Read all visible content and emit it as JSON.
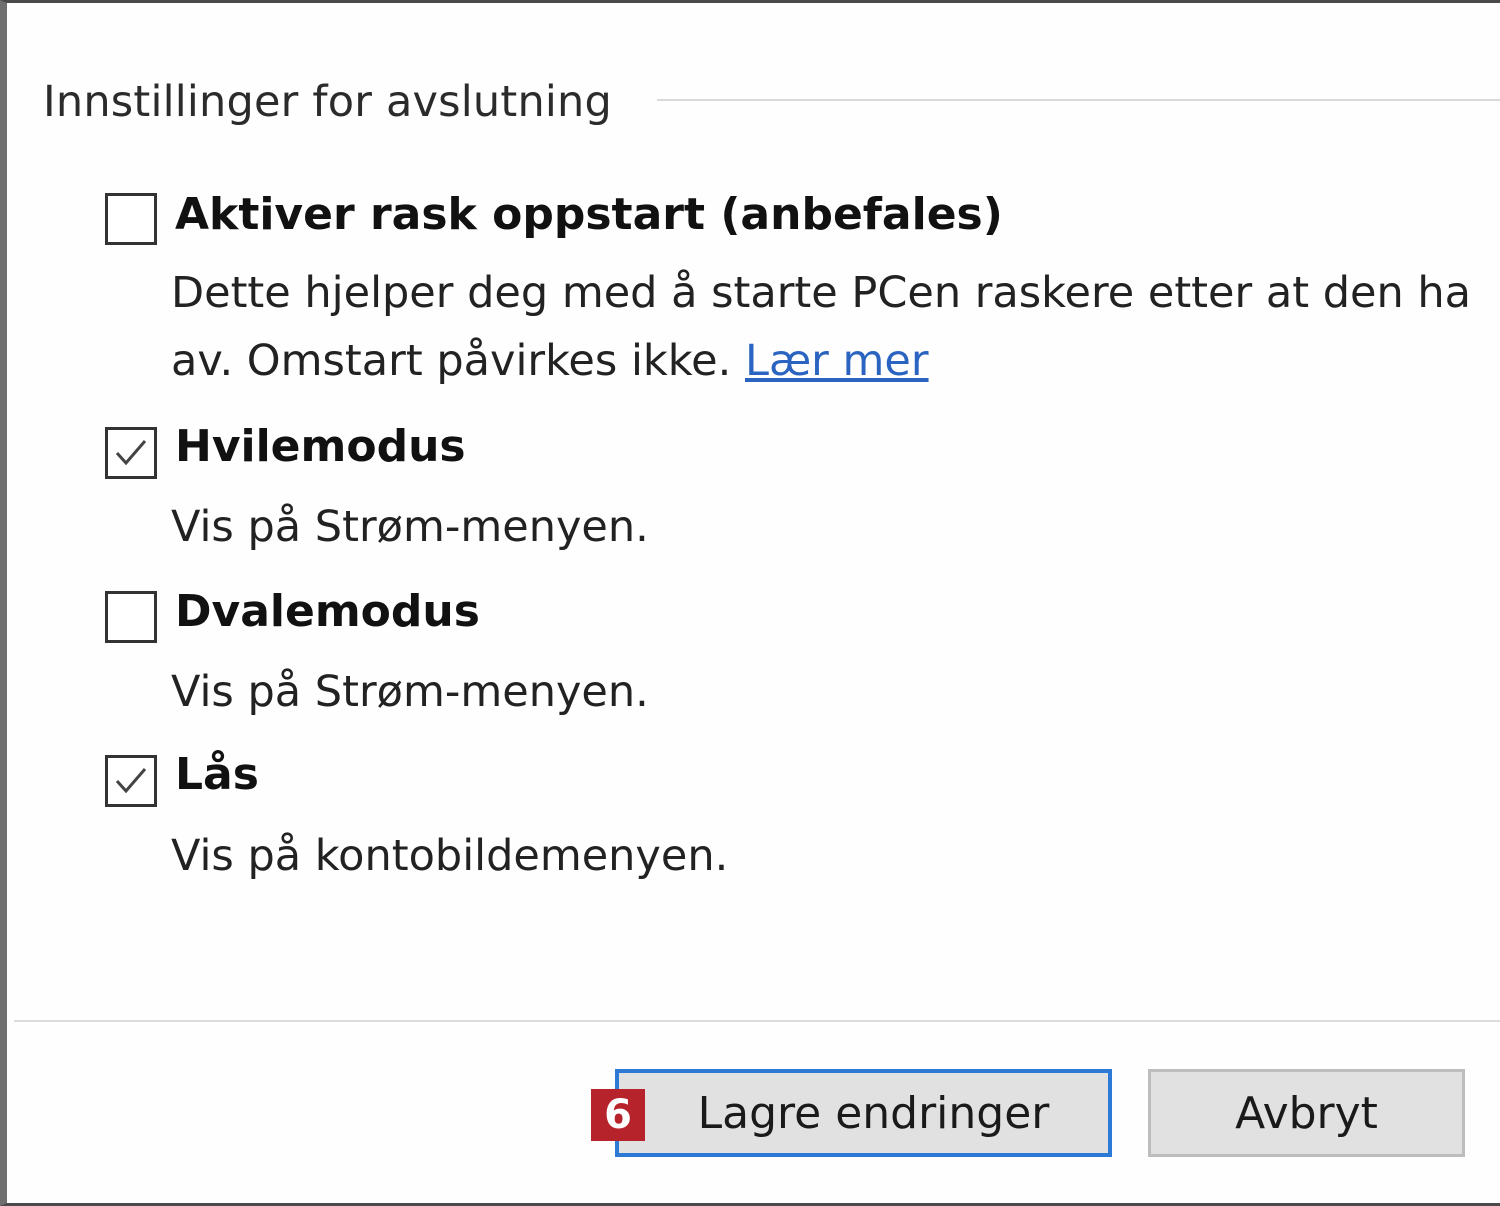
{
  "section": {
    "title": "Innstillinger for avslutning"
  },
  "options": [
    {
      "label": "Aktiver rask oppstart (anbefales)",
      "checked": false,
      "description_line1": "Dette hjelper deg med å starte PCen raskere etter at den ha",
      "description_line2": "av. Omstart påvirkes ikke.",
      "link": "Lær mer"
    },
    {
      "label": "Hvilemodus",
      "checked": true,
      "description": "Vis på Strøm-menyen."
    },
    {
      "label": "Dvalemodus",
      "checked": false,
      "description": "Vis på Strøm-menyen."
    },
    {
      "label": "Lås",
      "checked": true,
      "description": "Vis på kontobildemenyen."
    }
  ],
  "buttons": {
    "save_label": "Lagre endringer",
    "cancel_label": "Avbryt"
  },
  "step_badge": "6",
  "colors": {
    "link": "#2a64c0",
    "focus_border": "#2d7ad6",
    "badge": "#b7232a",
    "button_bg": "#e1e1e1"
  }
}
